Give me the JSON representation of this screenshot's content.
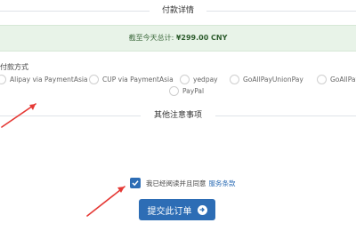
{
  "payment_section": {
    "title": "付款详情"
  },
  "total": {
    "label": "截至今天总计:",
    "amount": "¥299.00 CNY"
  },
  "payment_method": {
    "label": "付款方式",
    "options": [
      {
        "label": "Alipay via PaymentAsia"
      },
      {
        "label": "CUP via PaymentAsia"
      },
      {
        "label": "yedpay"
      },
      {
        "label": "GoAllPayUnionPay"
      },
      {
        "label": "GoAllPay"
      },
      {
        "label": "PayPal"
      }
    ]
  },
  "notes_section": {
    "title": "其他注意事项"
  },
  "agreement": {
    "text": "我已经阅读并且同意",
    "link": "服务条款",
    "checked": true
  },
  "submit": {
    "label": "提交此订单"
  },
  "colors": {
    "accent": "#2d6db5",
    "total_bg": "#e8f3e8",
    "annotation": "#e53935"
  }
}
